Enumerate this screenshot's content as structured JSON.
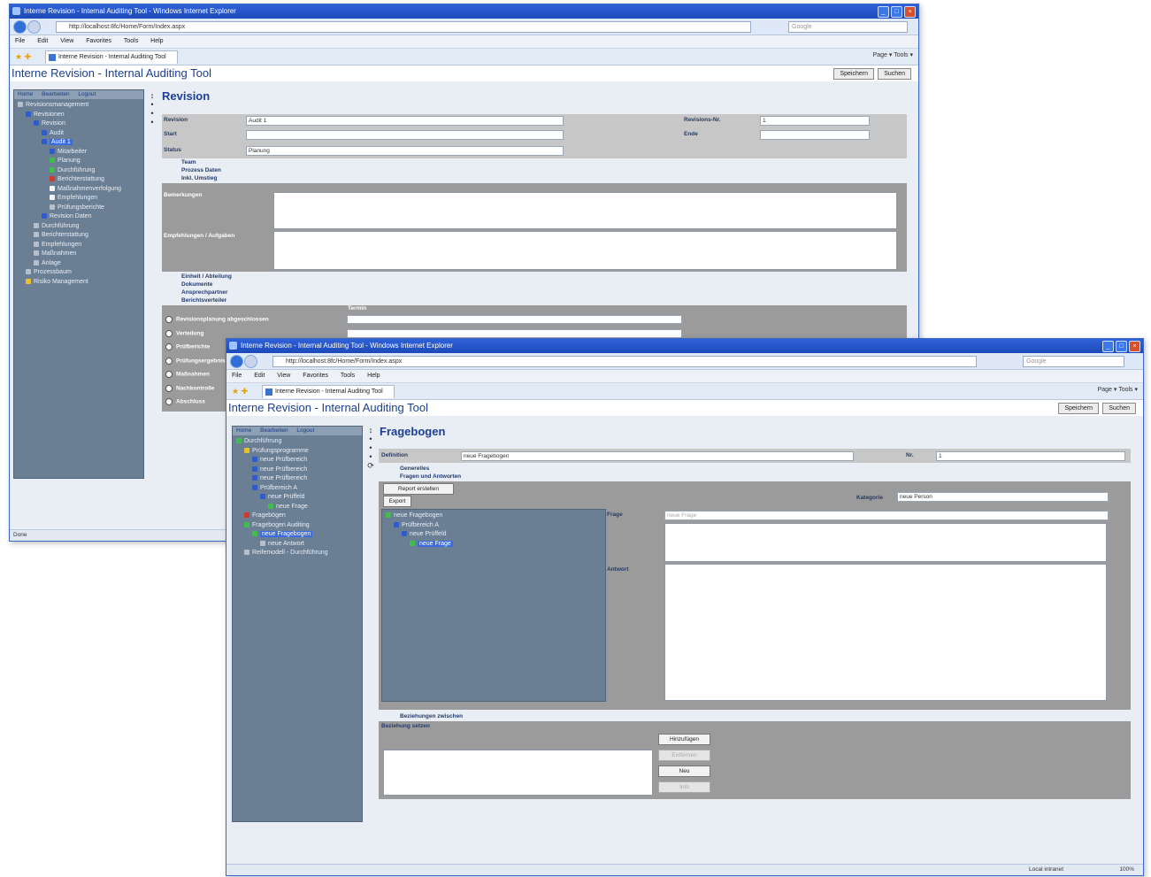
{
  "window1": {
    "title": "Interne Revision - Internal Auditing Tool - Windows Internet Explorer",
    "address": "http://localhost:8fc/Home/Form/Index.aspx",
    "search_placeholder": "Google",
    "menu": [
      "File",
      "Edit",
      "View",
      "Favorites",
      "Tools",
      "Help"
    ],
    "tab": "Interne Revision - Internal Auditing Tool",
    "cmd": "Page ▾   Tools ▾",
    "app_title": "Interne Revision - Internal Auditing Tool",
    "header_buttons": [
      "Speichern",
      "Suchen"
    ],
    "side_tabs": [
      "Home",
      "Bearbeiten",
      "Logout"
    ],
    "tree": [
      {
        "label": "Revisionsmanagement",
        "indent": 0,
        "icon": "grey"
      },
      {
        "label": "Revisionen",
        "indent": 1,
        "icon": "blue"
      },
      {
        "label": "Revision",
        "indent": 2,
        "icon": "blue"
      },
      {
        "label": "Audit",
        "indent": 3,
        "icon": "blue"
      },
      {
        "label": "Audit 1",
        "indent": 3,
        "icon": "blue",
        "selected": true
      },
      {
        "label": "Mitarbeiter",
        "indent": 4,
        "icon": "blue"
      },
      {
        "label": "Planung",
        "indent": 4,
        "icon": "green"
      },
      {
        "label": "Durchführung",
        "indent": 4,
        "icon": "green"
      },
      {
        "label": "Berichterstattung",
        "indent": 4,
        "icon": "red"
      },
      {
        "label": "Maßnahmenverfolgung",
        "indent": 4,
        "icon": "white"
      },
      {
        "label": "Empfehlungen",
        "indent": 4,
        "icon": "white"
      },
      {
        "label": "Prüfungsberichte",
        "indent": 4,
        "icon": "grey"
      },
      {
        "label": "Revision Daten",
        "indent": 3,
        "icon": "blue"
      },
      {
        "label": "Durchführung",
        "indent": 2,
        "icon": "grey"
      },
      {
        "label": "Berichterstattung",
        "indent": 2,
        "icon": "grey"
      },
      {
        "label": "Empfehlungen",
        "indent": 2,
        "icon": "grey"
      },
      {
        "label": "Maßnahmen",
        "indent": 2,
        "icon": "grey"
      },
      {
        "label": "Anlage",
        "indent": 2,
        "icon": "grey"
      },
      {
        "label": "Prozessbaum",
        "indent": 1,
        "icon": "grey"
      },
      {
        "label": "Risiko Management",
        "indent": 1,
        "icon": "yellow"
      }
    ],
    "page_title": "Revision",
    "fields": {
      "revision_label": "Revision",
      "revision_value": "Audit 1",
      "revision_nr_label": "Revisions-Nr.",
      "revision_nr_value": "1",
      "start_label": "Start",
      "ende_label": "Ende",
      "status_label": "Status",
      "status_value": "Planung"
    },
    "sections_top": [
      "Team",
      "Prozess Daten",
      "Inkl. Umstieg"
    ],
    "textarea_labels": [
      "Bemerkungen",
      "Empfehlungen / Aufgaben"
    ],
    "sections_mid": [
      "Einheit / Abteilung",
      "Dokumente",
      "Ansprechpartner",
      "Berichtsverteiler"
    ],
    "checks_header": "Termin",
    "checks": [
      "Revisionsplanung abgeschlossen",
      "Verteilung",
      "Prüfberichte",
      "Prüfungsergebnis",
      "Maßnahmen",
      "Nachkontrolle",
      "Abschluss"
    ],
    "status": "Done"
  },
  "window2": {
    "title": "Interne Revision - Internal Auditing Tool - Windows Internet Explorer",
    "address": "http://localhost:8fc/Home/Form/Index.aspx",
    "search_placeholder": "Google",
    "menu": [
      "File",
      "Edit",
      "View",
      "Favorites",
      "Tools",
      "Help"
    ],
    "tab": "Interne Revision - Internal Auditing Tool",
    "cmd": "Page ▾   Tools ▾",
    "app_title": "Interne Revision - Internal Auditing Tool",
    "header_buttons": [
      "Speichern",
      "Suchen"
    ],
    "side_tabs": [
      "Home",
      "Bearbeiten",
      "Logout"
    ],
    "tree": [
      {
        "label": "Durchführung",
        "indent": 0,
        "icon": "green"
      },
      {
        "label": "Prüfungsprogramme",
        "indent": 1,
        "icon": "yellow"
      },
      {
        "label": "neue Prüfbereich",
        "indent": 2,
        "icon": "blue"
      },
      {
        "label": "neue Prüfbereich",
        "indent": 2,
        "icon": "blue"
      },
      {
        "label": "neue Prüfbereich",
        "indent": 2,
        "icon": "blue"
      },
      {
        "label": "Prüfbereich A",
        "indent": 2,
        "icon": "blue"
      },
      {
        "label": "neue Prüffeld",
        "indent": 3,
        "icon": "blue"
      },
      {
        "label": "neue Frage",
        "indent": 4,
        "icon": "green"
      },
      {
        "label": "Fragebögen",
        "indent": 1,
        "icon": "red"
      },
      {
        "label": "Fragebogen Auditing",
        "indent": 1,
        "icon": "green"
      },
      {
        "label": "neue Fragebogen",
        "indent": 2,
        "icon": "green",
        "selected": true
      },
      {
        "label": "neue Antwort",
        "indent": 3,
        "icon": "grey"
      },
      {
        "label": "Reifemodell - Durchführung",
        "indent": 1,
        "icon": "grey"
      }
    ],
    "page_title": "Fragebogen",
    "fields": {
      "definition_label": "Definition",
      "definition_value": "neue Fragebogen",
      "nr_label": "Nr.",
      "nr_value": "1"
    },
    "sections_top": [
      "Generelles",
      "Fragen und Antworten"
    ],
    "buttons_top": [
      "Report erstellen",
      "Export"
    ],
    "kategorie_label": "Kategorie",
    "kategorie_value": "neue Person",
    "inner_tree": [
      {
        "label": "neue Fragebogen",
        "indent": 0,
        "icon": "green"
      },
      {
        "label": "Prüfbereich A",
        "indent": 1,
        "icon": "blue"
      },
      {
        "label": "neue Prüffeld",
        "indent": 2,
        "icon": "blue"
      },
      {
        "label": "neue Frage",
        "indent": 3,
        "icon": "green",
        "selected": true
      }
    ],
    "frage_label": "Frage",
    "frage_placeholder": "neue Frage",
    "antwort_label": "Antwort",
    "section_bottom": "Beziehungen zwischen",
    "beziehung_label": "Beziehung setzen",
    "side_buttons": [
      {
        "label": "Hinzufügen",
        "disabled": false
      },
      {
        "label": "Entfernen",
        "disabled": true
      },
      {
        "label": "Neu",
        "disabled": false
      },
      {
        "label": "Info",
        "disabled": true
      }
    ],
    "status_zone": "Local intranet",
    "zoom": "100%"
  }
}
